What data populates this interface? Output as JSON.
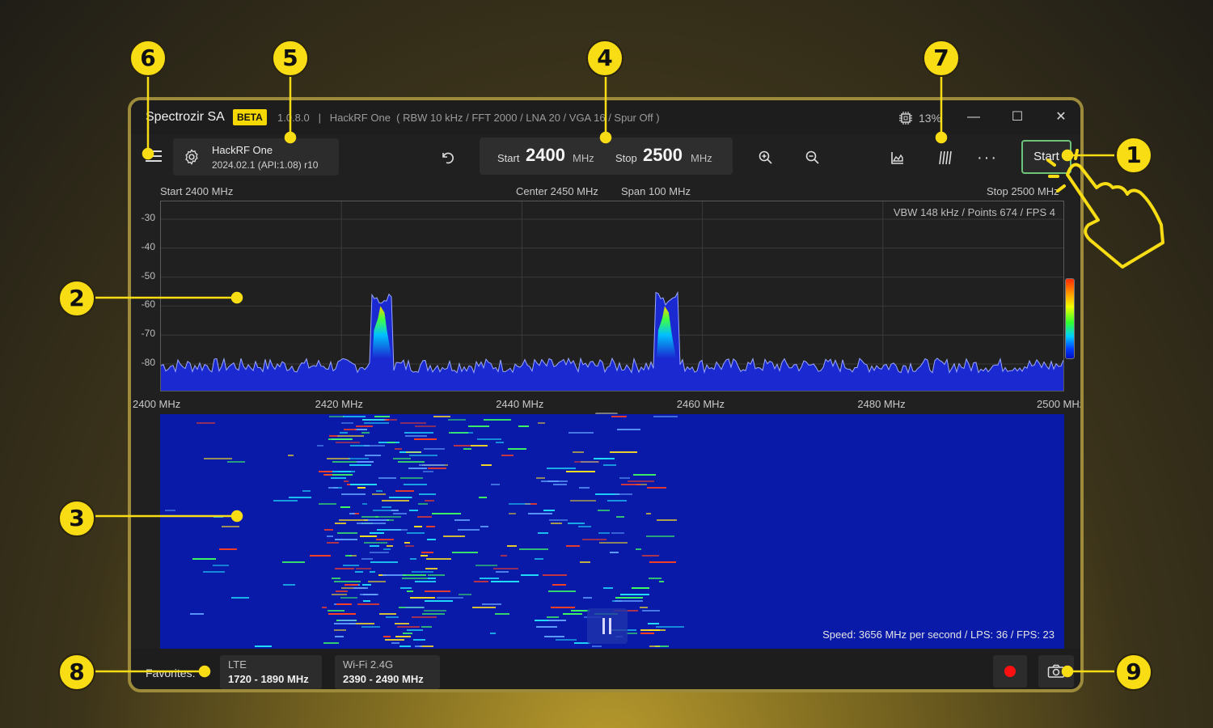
{
  "titlebar": {
    "app_name": "Spectrozir SA",
    "badge": "BETA",
    "info": "1.0.8.0   |   HackRF One  ( RBW 10 kHz / FFT 2000 / LNA 20 / VGA 16 / Spur Off )",
    "cpu_usage": "13%",
    "cpu_icon": "cpu-chip-icon",
    "minimize": "—",
    "maximize": "☐",
    "close": "✕"
  },
  "toolbar": {
    "menu_icon": "hamburger-menu-icon",
    "device_name": "HackRF One",
    "device_version": "2024.02.1 (API:1.08) r10",
    "settings_icon": "gear-icon",
    "undo_icon": "undo-icon",
    "start_label": "Start",
    "start_value": "2400",
    "stop_label": "Stop",
    "stop_value": "2500",
    "unit": "MHz",
    "zoom_in_icon": "zoom-in-icon",
    "zoom_out_icon": "zoom-out-icon",
    "chart_icon": "area-chart-icon",
    "waterfall_icon": "waterfall-icon",
    "more_label": "···",
    "start_button": "Start"
  },
  "scale": {
    "start": "Start 2400 MHz",
    "center": "Center 2450 MHz",
    "span": "Span 100 MHz",
    "stop": "Stop 2500 MHz"
  },
  "spectrum": {
    "vbw_info": "VBW 148 kHz / Points 674 / FPS 4",
    "y_ticks": [
      "-30",
      "-40",
      "-50",
      "-60",
      "-70",
      "-80"
    ],
    "x_ticks": [
      "2400 MHz",
      "2420 MHz",
      "2440 MHz",
      "2460 MHz",
      "2480 MHz",
      "2500 MHz"
    ],
    "noise_floor_db": -82,
    "peaks": [
      {
        "freq_mhz": 2424.5,
        "level_db": -60
      },
      {
        "freq_mhz": 2456,
        "level_db": -60
      }
    ]
  },
  "waterfall": {
    "speed": "Speed: 3656 MHz per second / LPS: 36 / FPS: 23",
    "pause_icon": "pause-icon"
  },
  "bottombar": {
    "favorites_label": "Favorites:",
    "favorites": [
      {
        "name": "LTE",
        "range": "1720 - 1890 MHz"
      },
      {
        "name": "Wi-Fi 2.4G",
        "range": "2390 - 2490 MHz"
      }
    ],
    "record_icon": "record-icon",
    "screenshot_icon": "camera-icon"
  },
  "callouts": [
    "1",
    "2",
    "3",
    "4",
    "5",
    "6",
    "7",
    "8",
    "9"
  ],
  "colors": {
    "accent": "#f8dc14",
    "start_border": "#6ec27a",
    "waterfall_bg": "#0a1aa8",
    "spectrum_fill": "#1a2ad0"
  }
}
